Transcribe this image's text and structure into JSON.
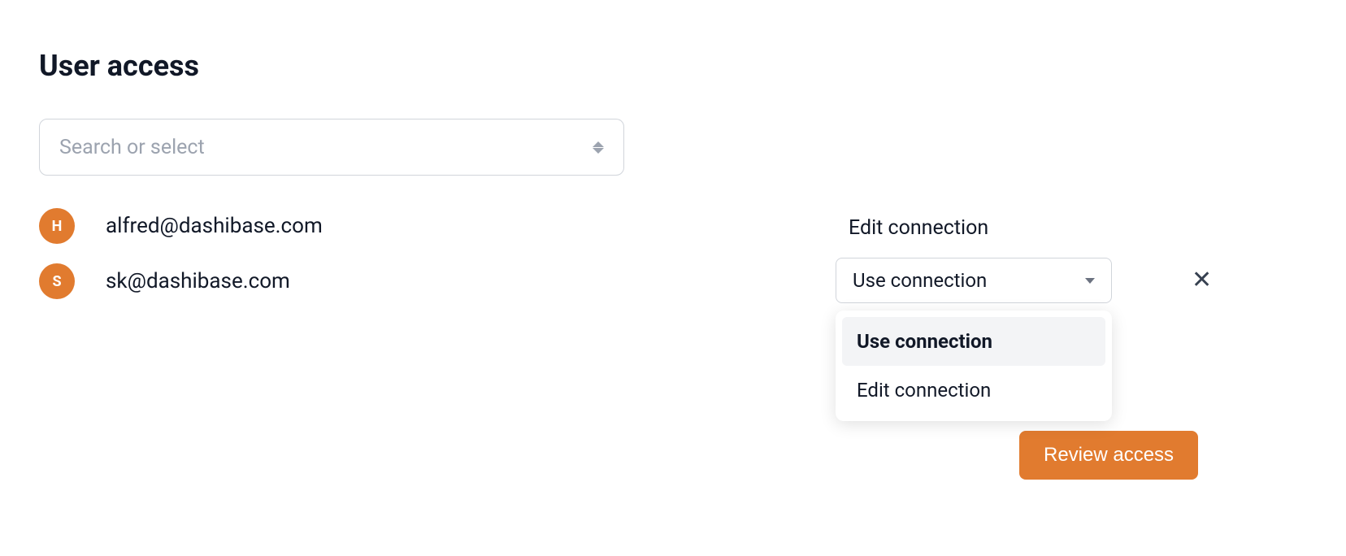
{
  "title": "User access",
  "search": {
    "placeholder": "Search or select"
  },
  "users": [
    {
      "initial": "H",
      "email": "alfred@dashibase.com"
    },
    {
      "initial": "S",
      "email": "sk@dashibase.com"
    }
  ],
  "permission": {
    "label": "Edit connection",
    "selected": "Use connection",
    "options": [
      "Use connection",
      "Edit connection"
    ]
  },
  "reviewButton": "Review access"
}
